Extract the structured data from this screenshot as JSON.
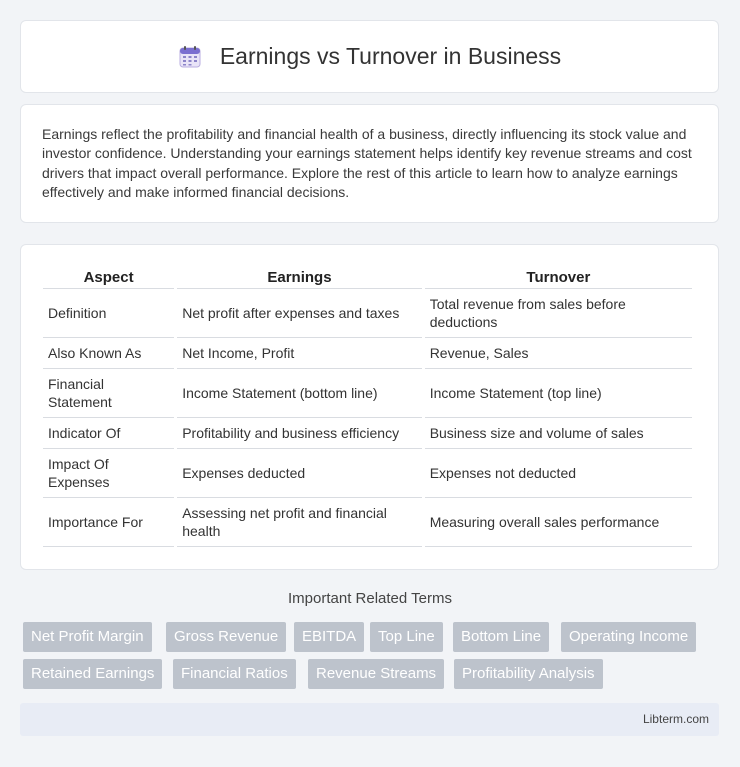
{
  "header": {
    "title": "Earnings vs Turnover in Business",
    "icon": "calendar-icon"
  },
  "intro": {
    "text": "Earnings reflect the profitability and financial health of a business, directly influencing its stock value and investor confidence. Understanding your earnings statement helps identify key revenue streams and cost drivers that impact overall performance. Explore the rest of this article to learn how to analyze earnings effectively and make informed financial decisions."
  },
  "table": {
    "headers": [
      "Aspect",
      "Earnings",
      "Turnover"
    ],
    "rows": [
      [
        "Definition",
        "Net profit after expenses and taxes",
        "Total revenue from sales before deductions"
      ],
      [
        "Also Known As",
        "Net Income, Profit",
        "Revenue, Sales"
      ],
      [
        "Financial Statement",
        "Income Statement (bottom line)",
        "Income Statement (top line)"
      ],
      [
        "Indicator Of",
        "Profitability and business efficiency",
        "Business size and volume of sales"
      ],
      [
        "Impact Of Expenses",
        "Expenses deducted",
        "Expenses not deducted"
      ],
      [
        "Importance For",
        "Assessing net profit and financial health",
        "Measuring overall sales performance"
      ]
    ]
  },
  "related": {
    "title": "Important Related Terms",
    "tags": [
      "Net Profit Margin",
      "Gross Revenue",
      "EBITDA",
      "Top Line",
      "Bottom Line",
      "Operating Income",
      "Retained Earnings",
      "Financial Ratios",
      "Revenue Streams",
      "Profitability Analysis"
    ]
  },
  "footer": {
    "text": "Libterm.com"
  },
  "colors": {
    "tag_bg": "#bdc3cc",
    "footer_bg": "#e8ecf5",
    "page_bg": "#f2f4f7"
  }
}
